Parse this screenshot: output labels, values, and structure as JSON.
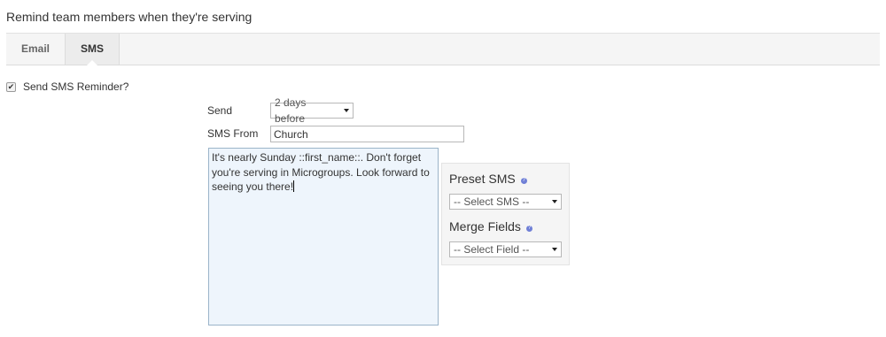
{
  "page": {
    "title": "Remind team members when they're serving"
  },
  "tabs": [
    {
      "label": "Email",
      "active": false
    },
    {
      "label": "SMS",
      "active": true
    }
  ],
  "reminder_checkbox": {
    "label": "Send SMS Reminder?",
    "checked": true
  },
  "form": {
    "send_label": "Send",
    "send_value": "2 days before",
    "sms_from_label": "SMS From",
    "sms_from_value": "Church",
    "message": "It's nearly Sunday ::first_name::. Don't forget you're serving in Microgroups. Look forward to seeing you there!"
  },
  "side_panel": {
    "preset_heading": "Preset SMS",
    "preset_select": "-- Select SMS --",
    "merge_heading": "Merge Fields",
    "merge_select": "-- Select Field --"
  },
  "colors": {
    "message_bg": "#eef5fc",
    "help_icon": "#6f7fd6"
  }
}
